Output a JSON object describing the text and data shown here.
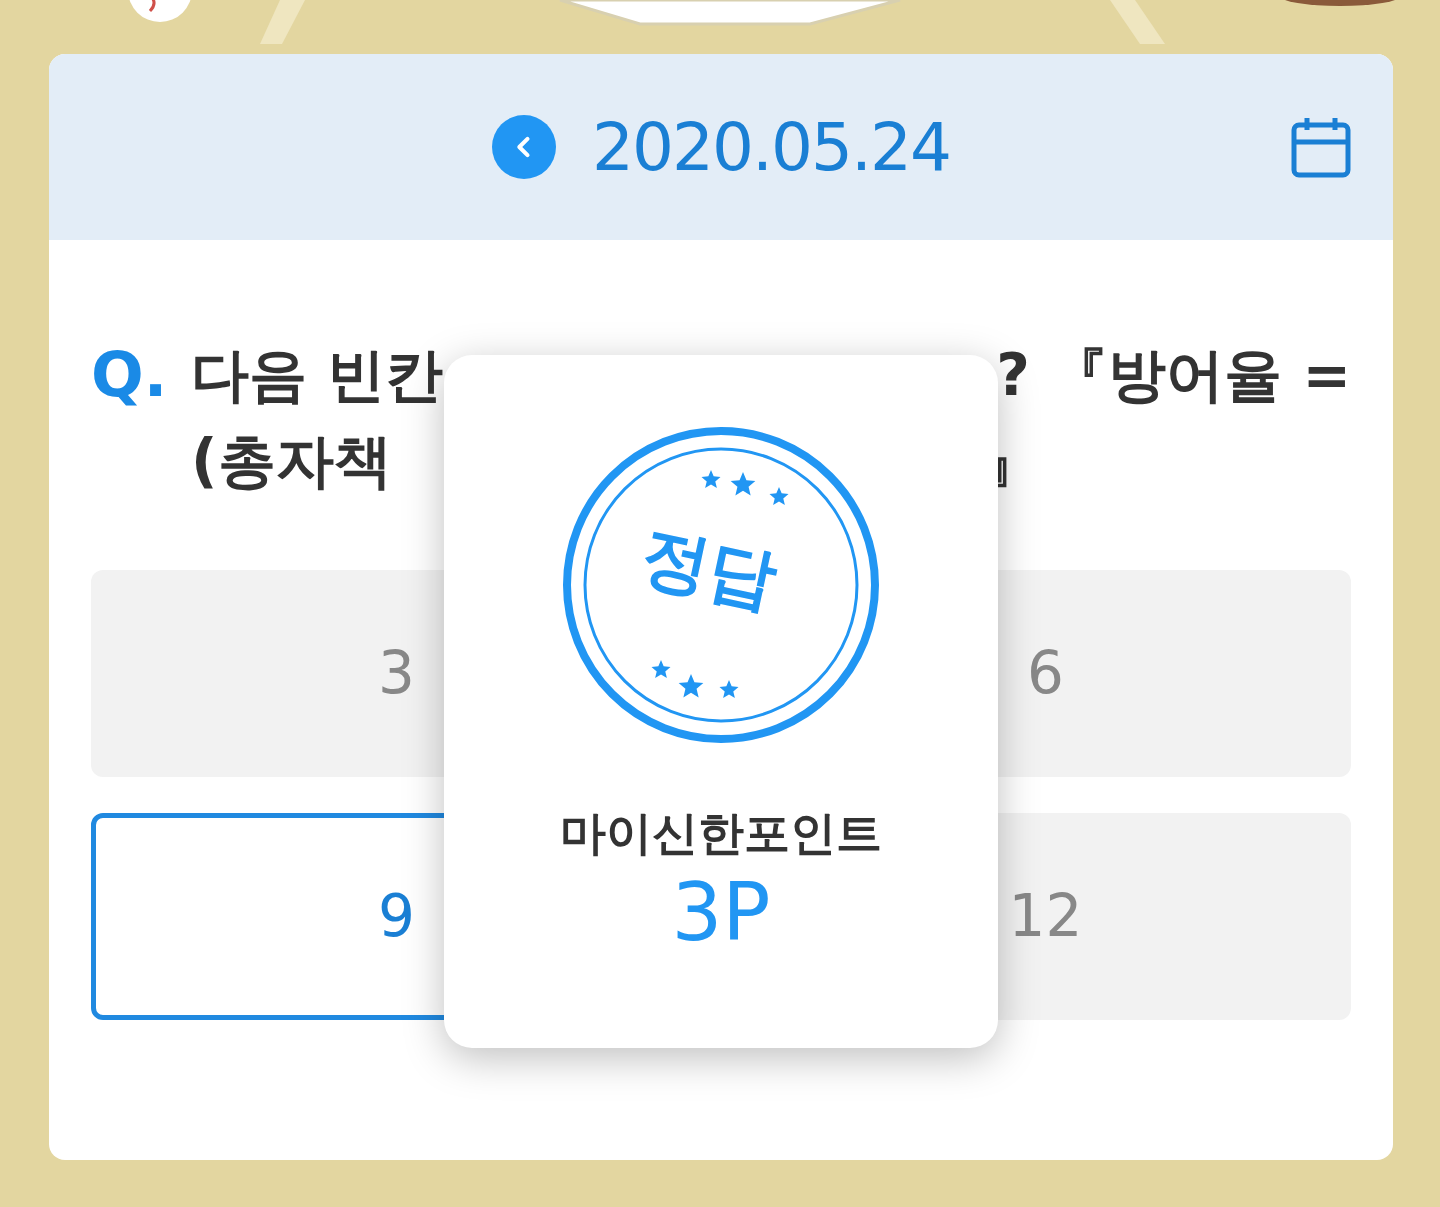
{
  "header": {
    "date": "2020.05.24"
  },
  "question": {
    "mark": "Q.",
    "lines": [
      {
        "left": "다음 빈칸",
        "right": "? 『방어율 ="
      },
      {
        "left": "(총자책",
        "right": "』"
      }
    ]
  },
  "options": [
    {
      "label": "3",
      "selected": false
    },
    {
      "label": "6",
      "selected": false
    },
    {
      "label": "9",
      "selected": true
    },
    {
      "label": "12",
      "selected": false
    }
  ],
  "popup": {
    "stamp": "정답",
    "label": "마이신한포인트",
    "points": "3P"
  }
}
